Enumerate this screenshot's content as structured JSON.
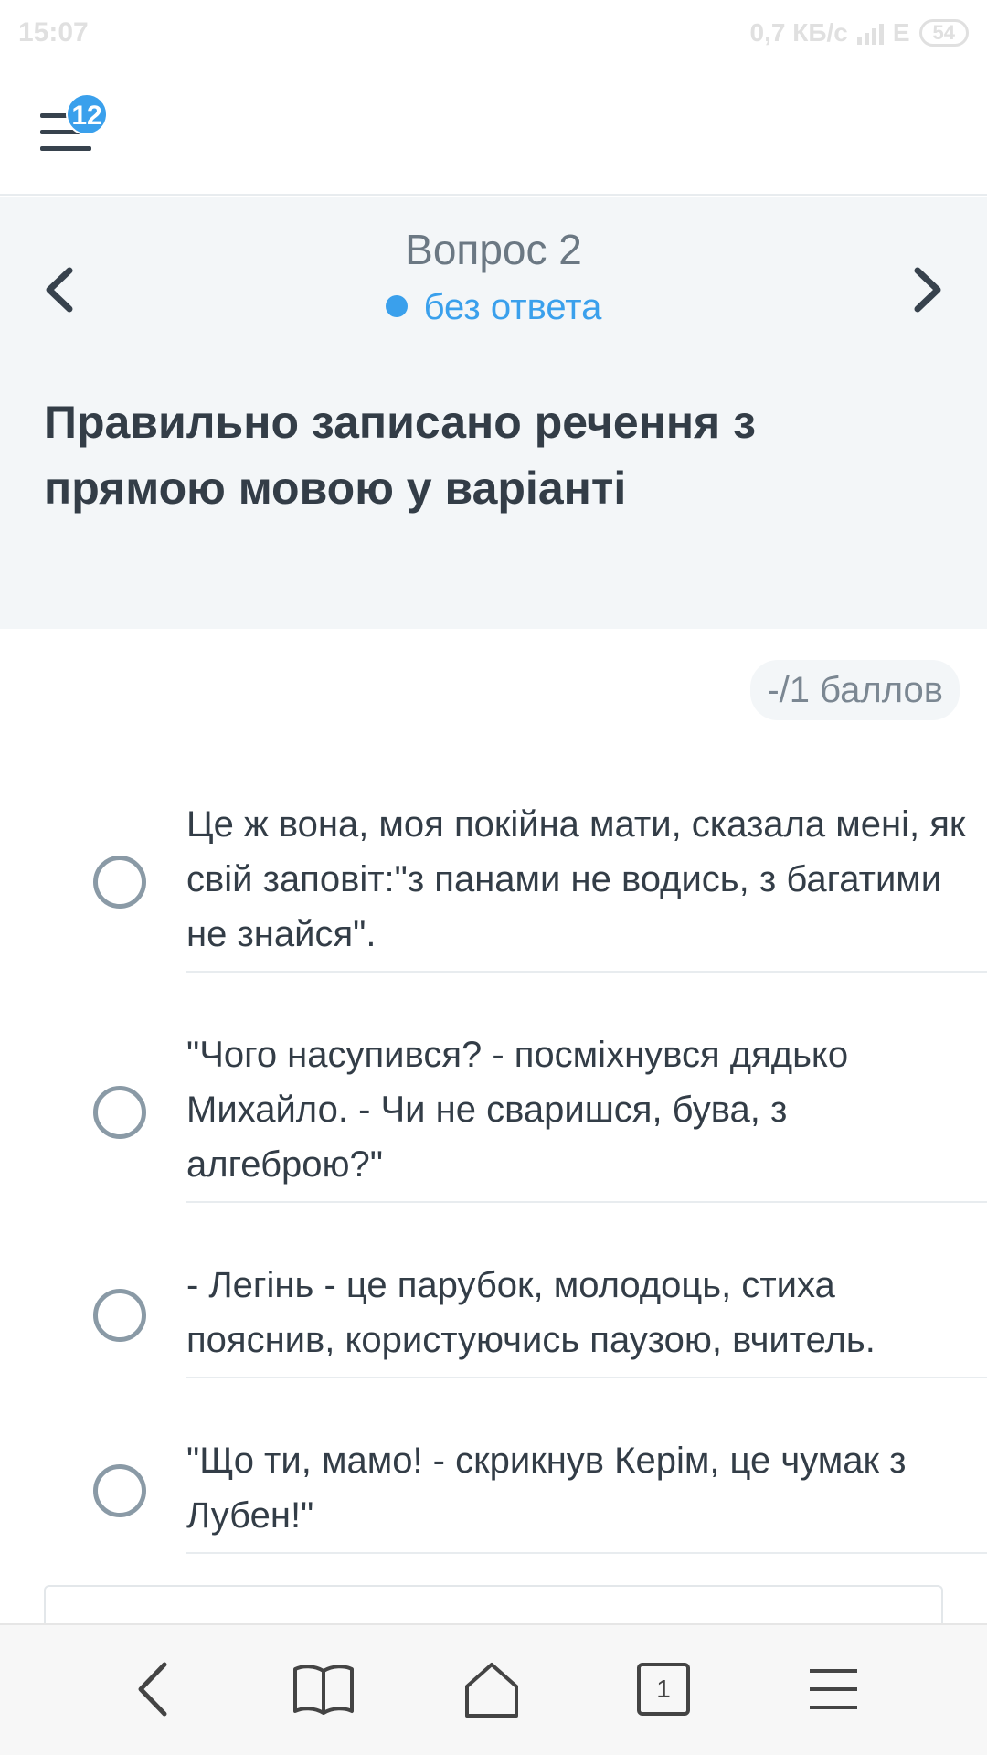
{
  "status_bar": {
    "time": "15:07",
    "net_speed": "0,7 КБ/с",
    "network": "E",
    "battery": "54"
  },
  "menu": {
    "badge": "12"
  },
  "question": {
    "title": "Вопрос 2",
    "status": "без ответа",
    "text": "Правильно записано речення з прямою мовою у варіанті"
  },
  "points": "-/1 баллов",
  "options": [
    {
      "text": "Це ж вона, моя покійна мати, сказала мені, як свій заповіт:\"з панами не водись, з багатими не знайся\"."
    },
    {
      "text": "\"Чого насупився? - посміхнувся дядько Михайло. - Чи не сваришся, бува, з алгеброю?\""
    },
    {
      "text": "- Легінь - це парубок, молодоць, стиха пояснив, користуючись паузою, вчитель."
    },
    {
      "text": "\"Що ти, мамо! - скрикнув Керім, це чумак з Лубен!\""
    }
  ],
  "bottom_bar": {
    "tabs_count": "1"
  },
  "colors": {
    "accent": "#3aa0ec",
    "header_bg": "#f3f6f8",
    "text": "#333d47",
    "radio": "#8a9aa6"
  }
}
